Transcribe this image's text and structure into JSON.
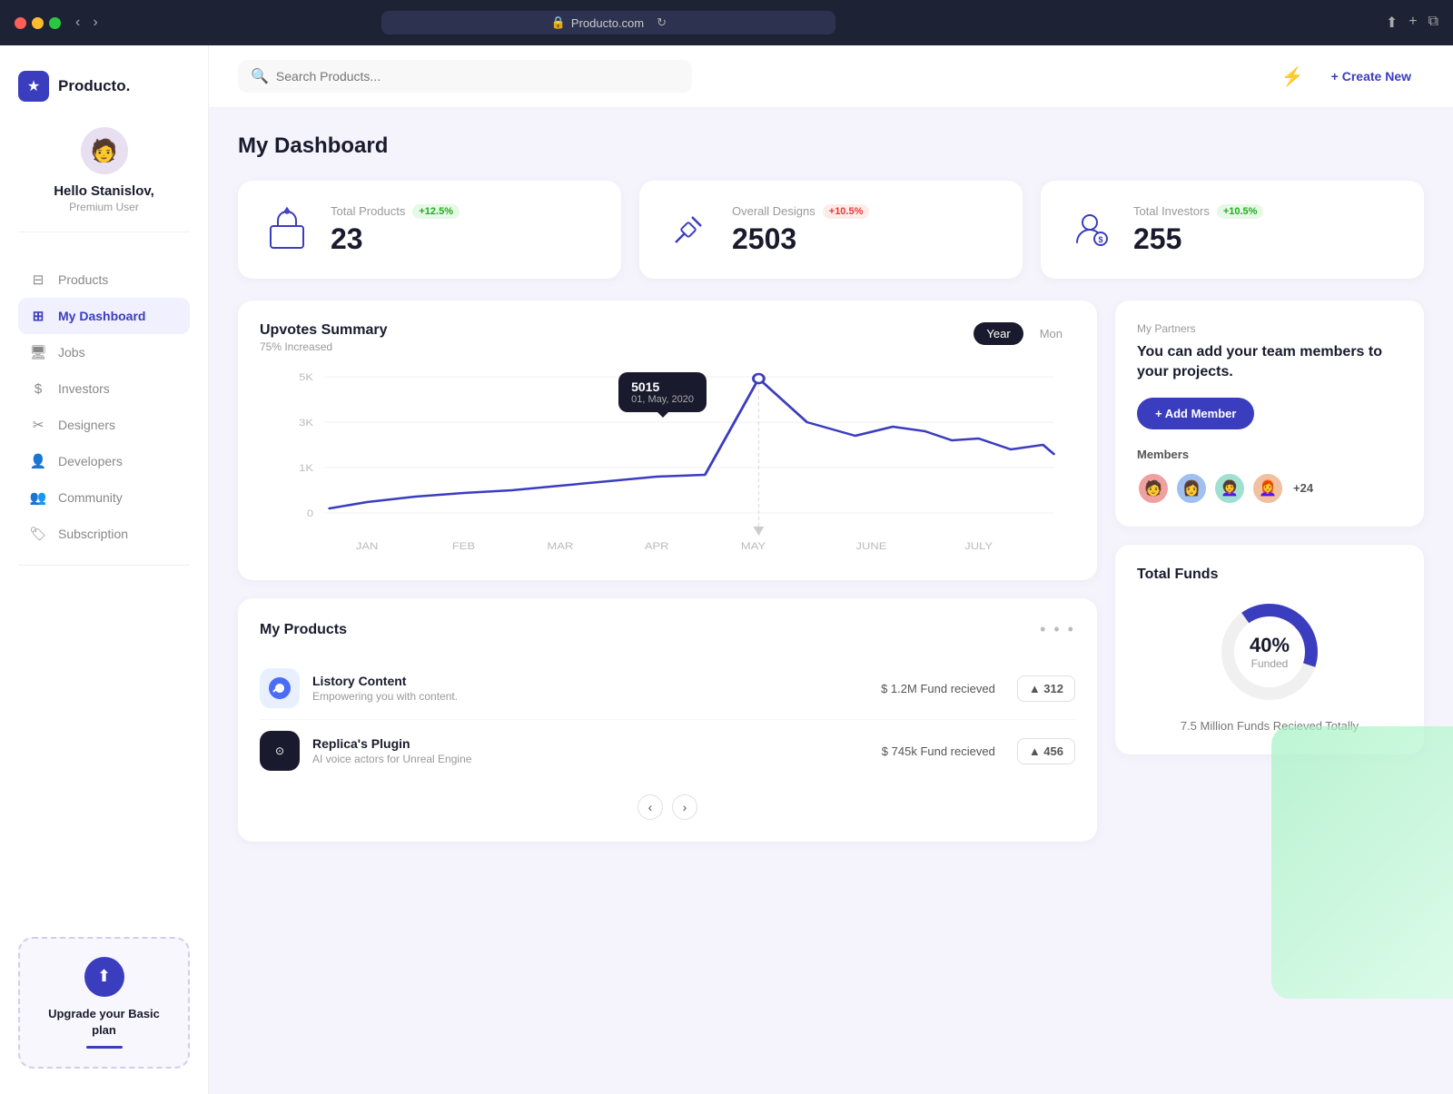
{
  "browser": {
    "url": "Producto.com",
    "lock_icon": "🔒",
    "refresh_icon": "↻"
  },
  "logo": {
    "icon": "★",
    "name": "Producto."
  },
  "user": {
    "greeting": "Hello Stanislov,",
    "tier": "Premium User",
    "avatar_emoji": "🧑"
  },
  "nav": {
    "items": [
      {
        "id": "products",
        "label": "Products",
        "icon": "⊟"
      },
      {
        "id": "my-dashboard",
        "label": "My Dashboard",
        "icon": "⊞"
      },
      {
        "id": "jobs",
        "label": "Jobs",
        "icon": "🖥"
      },
      {
        "id": "investors",
        "label": "Investors",
        "icon": "$"
      },
      {
        "id": "designers",
        "label": "Designers",
        "icon": "✂"
      },
      {
        "id": "developers",
        "label": "Developers",
        "icon": "👤"
      },
      {
        "id": "community",
        "label": "Community",
        "icon": "👥"
      },
      {
        "id": "subscription",
        "label": "Subscription",
        "icon": "🏷"
      }
    ],
    "active": "my-dashboard"
  },
  "upgrade": {
    "title": "Upgrade your Basic plan",
    "icon": "⬆"
  },
  "topbar": {
    "search_placeholder": "Search Products...",
    "create_label": "+ Create New"
  },
  "page_title": "My Dashboard",
  "stats": [
    {
      "id": "total-products",
      "label": "Total Products",
      "badge": "+12.5%",
      "badge_type": "green",
      "value": "23",
      "icon": "🎁"
    },
    {
      "id": "overall-designs",
      "label": "Overall Designs",
      "badge": "+10.5%",
      "badge_type": "red",
      "value": "2503",
      "icon": "✏"
    },
    {
      "id": "total-investors",
      "label": "Total Investors",
      "badge": "+10.5%",
      "badge_type": "green",
      "value": "255",
      "icon": "👤"
    }
  ],
  "chart": {
    "title": "Upvotes Summary",
    "subtitle": "75% Increased",
    "toggle_year": "Year",
    "toggle_mon": "Mon",
    "tooltip_value": "5015",
    "tooltip_date": "01, May, 2020",
    "y_labels": [
      "5K",
      "3K",
      "1K",
      "0"
    ],
    "x_labels": [
      "JAN",
      "FEB",
      "MAR",
      "APR",
      "MAY",
      "JUNE",
      "JULY"
    ]
  },
  "products": {
    "title": "My Products",
    "items": [
      {
        "name": "Listory Content",
        "desc": "Empowering you with content.",
        "fund": "$ 1.2M Fund recieved",
        "votes": "312",
        "color": "#e8f0fe",
        "icon": "🔵"
      },
      {
        "name": "Replica's Plugin",
        "desc": "AI voice actors for Unreal Engine",
        "fund": "$ 745k Fund recieved",
        "votes": "456",
        "color": "#1a1a2e",
        "icon": "⚙"
      }
    ]
  },
  "partners": {
    "label": "My Partners",
    "title": "You can add your team members to your projects.",
    "add_label": "+ Add Member",
    "members_label": "Members",
    "members_count": "+24",
    "avatars": [
      "🧑",
      "👩",
      "👩‍🦱",
      "👩‍🦰"
    ]
  },
  "funds": {
    "title": "Total Funds",
    "percentage": "40%",
    "sub": "Funded",
    "total": "7.5 Million Funds Recieved Totally"
  }
}
